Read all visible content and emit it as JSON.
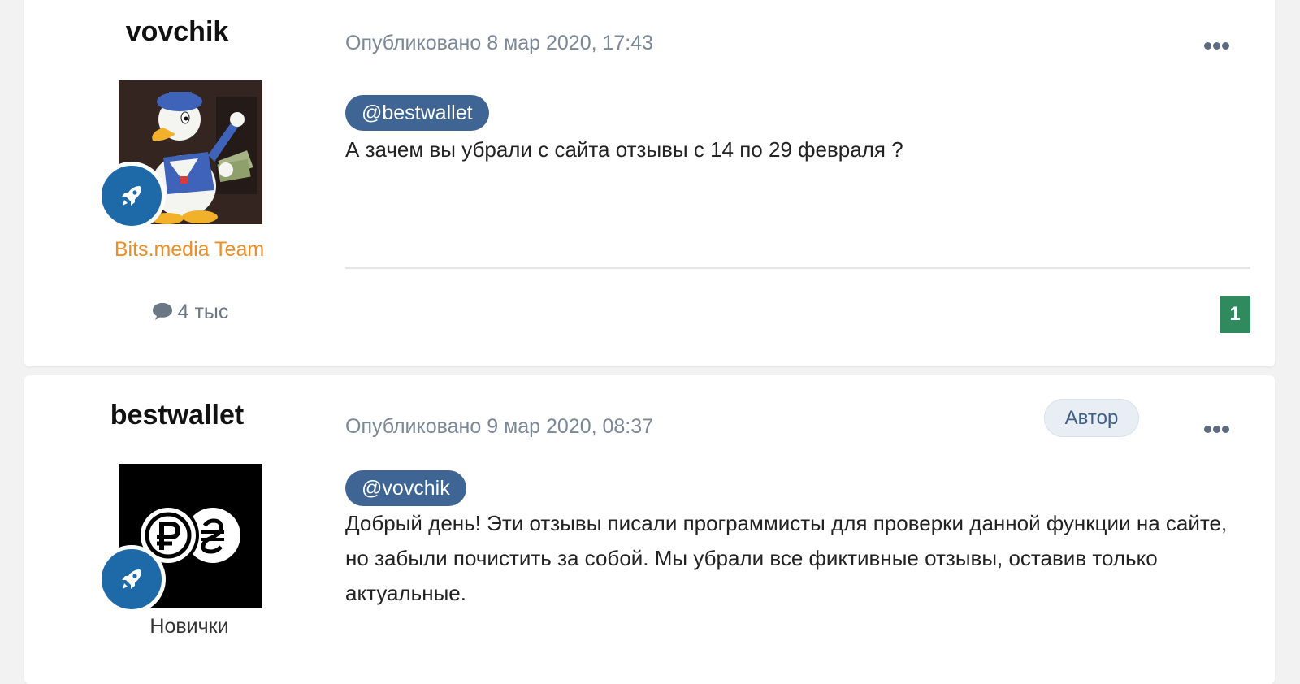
{
  "posts": [
    {
      "author": "vovchik",
      "group": "Bits.media Team",
      "group_color": "#ef8e25",
      "post_count": "4 тыс",
      "posted_label": "Опубликовано",
      "date": "8 мар 2020, 17:43",
      "mention": "@bestwallet",
      "text": "А зачем вы убрали с сайта отзывы с 14 по 29 февраля ?",
      "reaction_count": "1",
      "avatar_icon": "donald-duck-avatar",
      "rank_icon": "rocket-icon"
    },
    {
      "author": "bestwallet",
      "group": "Новички",
      "group_color": "#333333",
      "posted_label": "Опубликовано",
      "date": "9 мар 2020, 08:37",
      "author_badge": "Автор",
      "mention": "@vovchik",
      "text": "Добрый день! Эти отзывы писали программисты для проверки данной функции на сайте, но забыли почистить за собой. Мы убрали все фиктивные отзывы, оставив только актуальные.",
      "avatar_icon": "ruble-hryvnia-coins-avatar",
      "rank_icon": "rocket-icon"
    }
  ],
  "colors": {
    "mention_bg": "#3f6594",
    "rank_badge": "#1e6aa9",
    "reaction_bg": "#2f8a5e",
    "meta_text": "#7a8898"
  }
}
